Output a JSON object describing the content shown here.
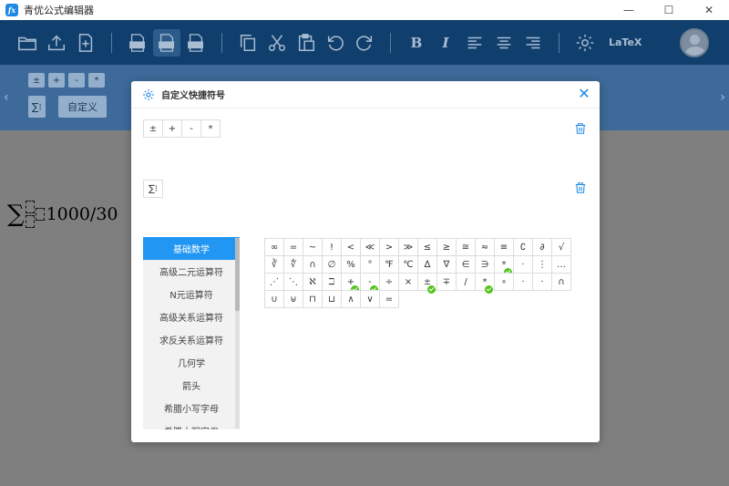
{
  "app": {
    "title": "青优公式编辑器",
    "logo_text": "fx"
  },
  "window_controls": {
    "minimize": "—",
    "maximize": "☐",
    "close": "✕"
  },
  "toolbar": {
    "bold": "B",
    "italic": "I",
    "latex": "LaTeX",
    "colors": {
      "bg": "#113f6d",
      "icon": "#a9bed3"
    }
  },
  "symbol_panel": {
    "buttons": [
      "±",
      "+",
      "-",
      "*"
    ],
    "sigma": "∑⁝",
    "custom_label": "自定义",
    "left_arrow": "‹",
    "right_arrow": "›"
  },
  "workarea": {
    "formula_tail": "1000/30",
    "sigma": "∑"
  },
  "dialog": {
    "title": "自定义快捷符号",
    "close": "✕",
    "row1": [
      "±",
      "+",
      "-",
      "*"
    ],
    "row2": [
      "∑⁝"
    ],
    "categories": [
      {
        "label": "基础数学",
        "active": true
      },
      {
        "label": "高级二元运算符",
        "active": false
      },
      {
        "label": "N元运算符",
        "active": false
      },
      {
        "label": "高级关系运算符",
        "active": false
      },
      {
        "label": "求反关系运算符",
        "active": false
      },
      {
        "label": "几何学",
        "active": false
      },
      {
        "label": "箭头",
        "active": false
      },
      {
        "label": "希腊小写字母",
        "active": false
      },
      {
        "label": "希腊大写字母",
        "active": false
      }
    ],
    "symbols": [
      {
        "s": "∞"
      },
      {
        "s": "="
      },
      {
        "s": "~"
      },
      {
        "s": "!"
      },
      {
        "s": "<"
      },
      {
        "s": "≪"
      },
      {
        "s": ">"
      },
      {
        "s": "≫"
      },
      {
        "s": "≤"
      },
      {
        "s": "≥"
      },
      {
        "s": "≅"
      },
      {
        "s": "≈"
      },
      {
        "s": "≡"
      },
      {
        "s": "∁"
      },
      {
        "s": "∂"
      },
      {
        "s": "√"
      },
      {
        "s": "∛"
      },
      {
        "s": "∜"
      },
      {
        "s": "∩"
      },
      {
        "s": "∅"
      },
      {
        "s": "%"
      },
      {
        "s": "°"
      },
      {
        "s": "℉"
      },
      {
        "s": "℃"
      },
      {
        "s": "∆"
      },
      {
        "s": "∇"
      },
      {
        "s": "∈"
      },
      {
        "s": "∋"
      },
      {
        "s": "*",
        "checked": true
      },
      {
        "s": "·"
      },
      {
        "s": "⋮"
      },
      {
        "s": "…"
      },
      {
        "s": "⋰"
      },
      {
        "s": "⋱"
      },
      {
        "s": "ℵ"
      },
      {
        "s": "ℶ"
      },
      {
        "s": "+",
        "checked": true
      },
      {
        "s": "-",
        "checked": true
      },
      {
        "s": "÷"
      },
      {
        "s": "×"
      },
      {
        "s": "±",
        "checked": true
      },
      {
        "s": "∓"
      },
      {
        "s": "/"
      },
      {
        "s": "*",
        "checked": true
      },
      {
        "s": "∘"
      },
      {
        "s": "·"
      },
      {
        "s": "·"
      },
      {
        "s": "∩"
      },
      {
        "s": "∪"
      },
      {
        "s": "⊎"
      },
      {
        "s": "⊓"
      },
      {
        "s": "⊔"
      },
      {
        "s": "∧"
      },
      {
        "s": "∨"
      },
      {
        "s": "="
      }
    ],
    "accent": "#2196f3",
    "check_color": "#52c41a"
  }
}
